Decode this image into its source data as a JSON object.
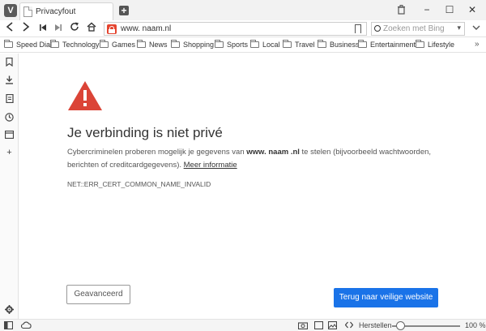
{
  "browser": {
    "logo": "V",
    "tab_title": "Privacyfout",
    "new_tab": "+",
    "window_buttons": [
      "−",
      "☐",
      "✕"
    ]
  },
  "navigation": {
    "url": "www. naam.nl",
    "search_placeholder": "Zoeken met Bing"
  },
  "bookmarks": {
    "speed_dial": "Speed Dial",
    "folders": [
      "Technology",
      "Games",
      "News",
      "Shopping",
      "Sports",
      "Local",
      "Travel",
      "Business",
      "Entertainment",
      "Lifestyle"
    ],
    "more": "»"
  },
  "error_page": {
    "headline": "Je verbinding is niet privé",
    "desc_before": "Cybercriminelen proberen mogelijk je gegevens van ",
    "domain": "www.  naam .nl",
    "desc_after": " te stelen (bijvoorbeeld wachtwoorden, berichten of creditcardgegevens). ",
    "more_info": "Meer informatie",
    "error_code": "NET::ERR_CERT_COMMON_NAME_INVALID",
    "advanced_button": "Geavanceerd",
    "back_button": "Terug naar veilige website"
  },
  "statusbar": {
    "reset_label": "Herstellen",
    "zoom_level": "100 %",
    "zoom_fraction": 0.12
  },
  "colors": {
    "primary_button": "#1a73e8",
    "warning": "#db4437",
    "lock": "#e4442f"
  }
}
